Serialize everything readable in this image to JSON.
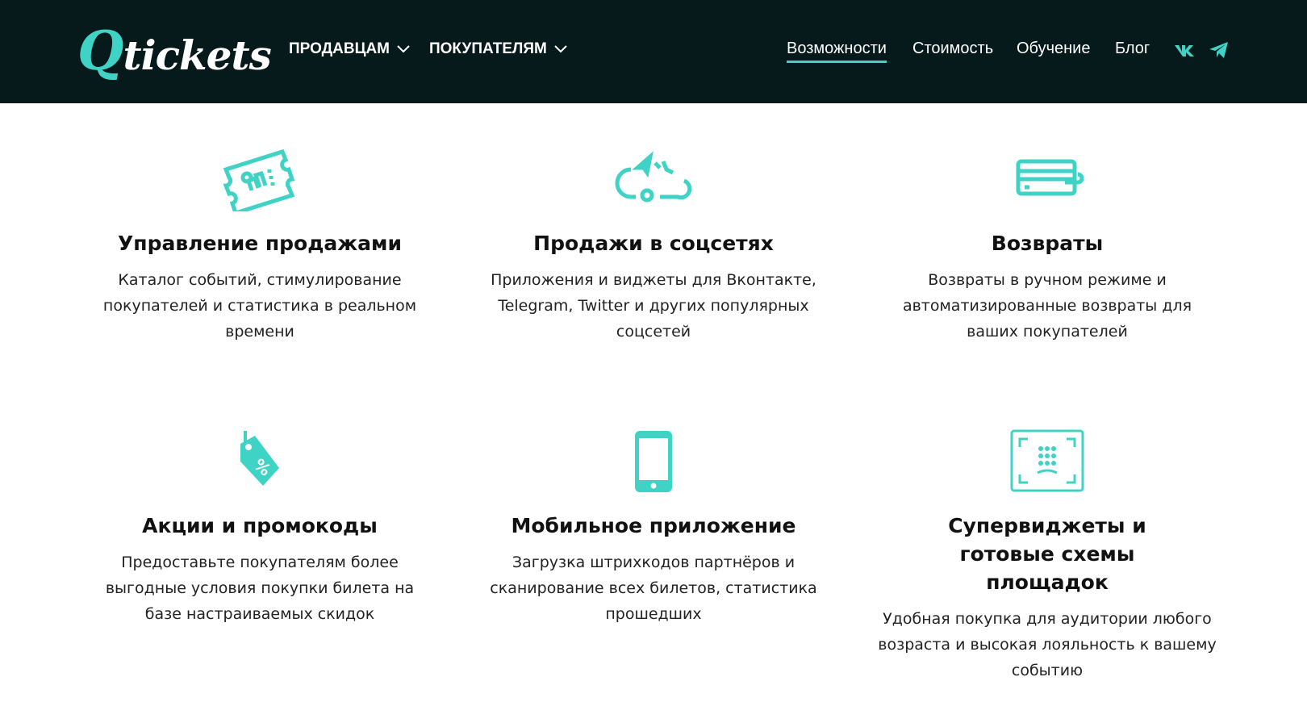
{
  "header": {
    "logo": {
      "q": "Q",
      "rest": "tickets"
    },
    "dropdowns": [
      {
        "label": "ПРОДАВЦАМ"
      },
      {
        "label": "ПОКУПАТЕЛЯМ"
      }
    ],
    "links": [
      {
        "label": "Возможности",
        "active": true
      },
      {
        "label": "Стоимость"
      },
      {
        "label": "Обучение"
      },
      {
        "label": "Блог"
      }
    ],
    "social": [
      "vk-icon",
      "telegram-icon"
    ],
    "accent": "#3ed3c5",
    "background": "#06191b"
  },
  "features": [
    {
      "icon": "ticket-chart-icon",
      "title": "Управление продажами",
      "text": "Каталог событий, стимулирование покупателей и статистика в реальном времени"
    },
    {
      "icon": "social-share-icon",
      "title": "Продажи в соцсетях",
      "text": "Приложения и виджеты для Вконтакте, Telegram, Twitter и других популярных соцсетей"
    },
    {
      "icon": "card-refund-icon",
      "title": "Возвраты",
      "text": "Возвраты в ручном режиме и автоматизированные возвраты для ваших покупателей"
    },
    {
      "icon": "discount-tag-icon",
      "title": "Акции и промокоды",
      "text": "Предоставьте покупателям более выгодные условия покупки билета на базе настраиваемых скидок"
    },
    {
      "icon": "mobile-phone-icon",
      "title": "Мобильное приложение",
      "text": "Загрузка штрихкодов партнёров и сканирование всех билетов, статистика прошедших"
    },
    {
      "icon": "seat-map-widget-icon",
      "title": "Супервиджеты и готовые схемы площадок",
      "text": "Удобная покупка для аудитории любого возраста и высокая лояльность к вашему событию"
    }
  ]
}
